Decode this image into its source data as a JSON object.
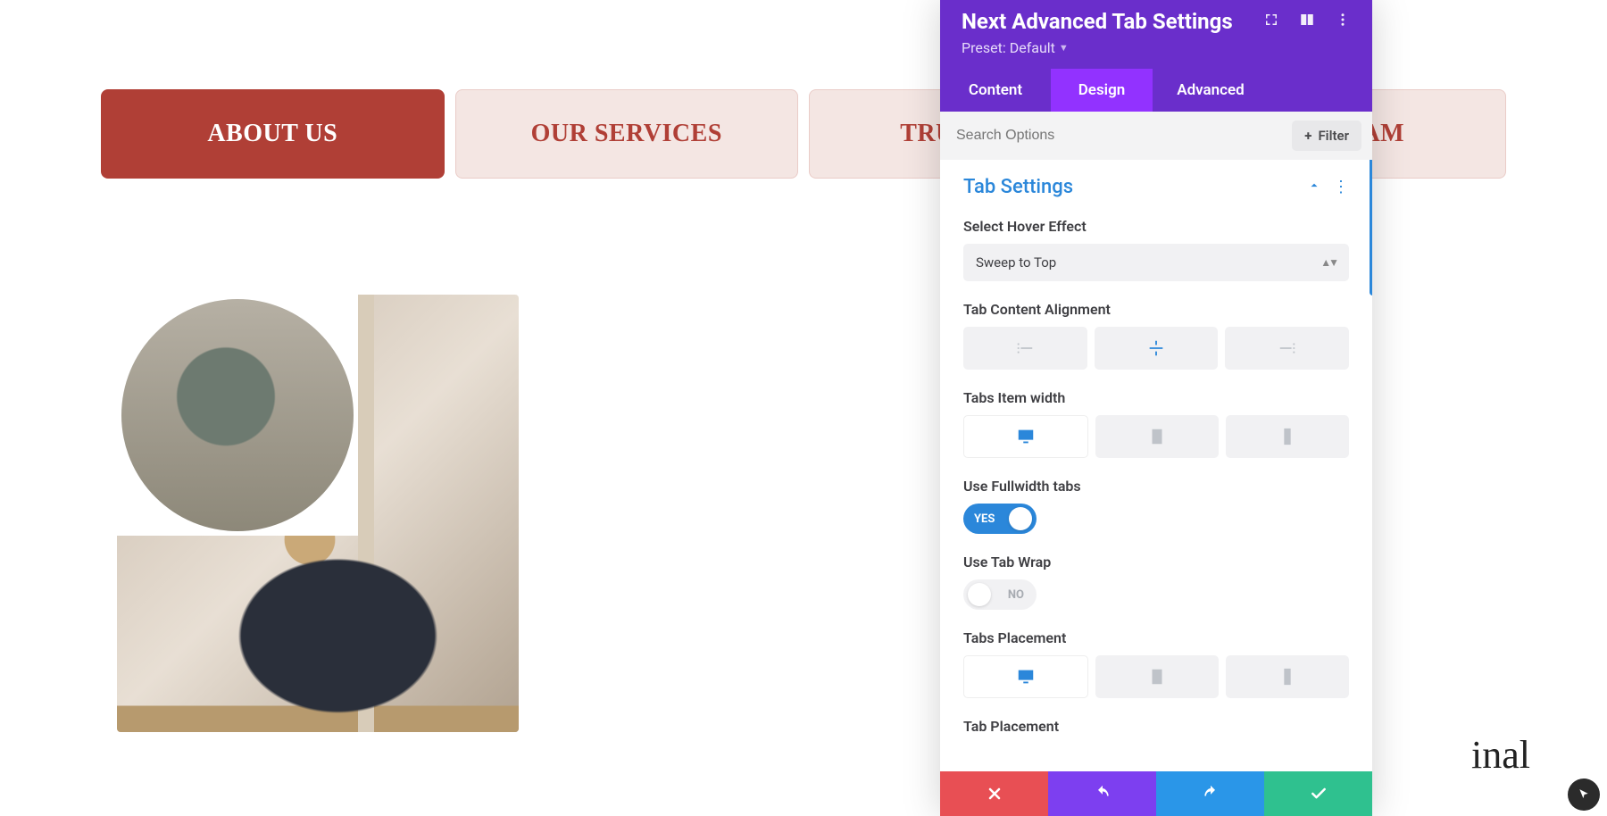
{
  "page": {
    "tabs": [
      {
        "label": "ABOUT US",
        "active": true
      },
      {
        "label": "OUR SERVICES",
        "active": false
      },
      {
        "label": "TRUSTED US",
        "active": false
      },
      {
        "label": "OUR TEAM",
        "active": false
      }
    ],
    "peek_text_fragment": "inal"
  },
  "panel": {
    "title": "Next Advanced Tab Settings",
    "preset_label": "Preset:",
    "preset_value": "Default",
    "tabs": {
      "content": "Content",
      "design": "Design",
      "advanced": "Advanced",
      "active": "design"
    },
    "search_placeholder": "Search Options",
    "filter_label": "Filter",
    "section_title": "Tab Settings",
    "fields": {
      "hover_effect": {
        "label": "Select Hover Effect",
        "value": "Sweep to Top"
      },
      "content_alignment": {
        "label": "Tab Content Alignment",
        "value": "center"
      },
      "item_width": {
        "label": "Tabs Item width",
        "value": "desktop"
      },
      "fullwidth": {
        "label": "Use Fullwidth tabs",
        "value": true,
        "on_text": "YES"
      },
      "tab_wrap": {
        "label": "Use Tab Wrap",
        "value": false,
        "off_text": "NO"
      },
      "tabs_placement": {
        "label": "Tabs Placement",
        "value": "desktop"
      },
      "tab_placement": {
        "label": "Tab Placement"
      }
    }
  }
}
